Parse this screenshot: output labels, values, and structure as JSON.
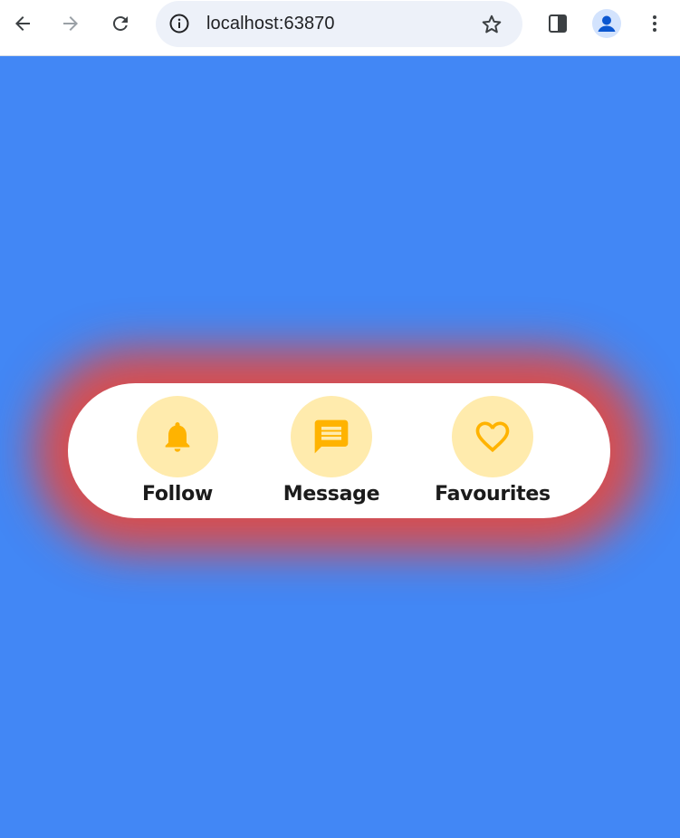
{
  "browser": {
    "url": "localhost:63870",
    "icons": {
      "back": "arrow-back-icon",
      "forward": "arrow-forward-icon",
      "reload": "reload-icon",
      "info": "info-icon",
      "bookmark": "star-icon",
      "side_panel": "side-panel-icon",
      "profile": "profile-avatar-icon",
      "menu": "more-vert-icon"
    }
  },
  "page": {
    "background_color": "#4287f5",
    "card": {
      "glow_color": "#ed4637",
      "actions": [
        {
          "label": "Follow",
          "icon": "bell-icon"
        },
        {
          "label": "Message",
          "icon": "message-icon"
        },
        {
          "label": "Favourites",
          "icon": "heart-icon"
        }
      ],
      "accent_color": "#ffb300",
      "icon_bg_color": "#ffebad"
    }
  }
}
